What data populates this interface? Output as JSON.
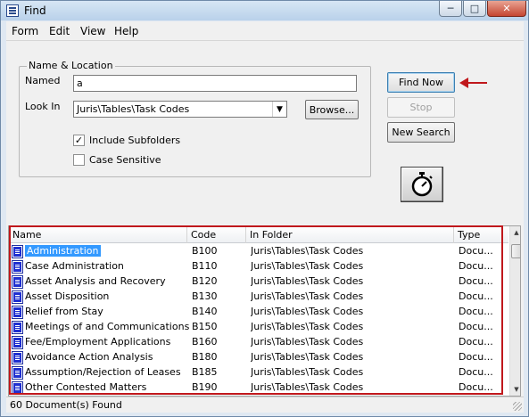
{
  "window": {
    "title": "Find"
  },
  "menu": [
    "Form",
    "Edit",
    "View",
    "Help"
  ],
  "name_location": {
    "legend": "Name & Location",
    "named_label": "Named",
    "named_value": "a",
    "lookin_label": "Look In",
    "lookin_value": "Juris\\Tables\\Task Codes",
    "browse_label": "Browse...",
    "include_subfolders_label": "Include Subfolders",
    "include_subfolders_checked": true,
    "case_sensitive_label": "Case Sensitive",
    "case_sensitive_checked": false
  },
  "buttons": {
    "find_now": "Find Now",
    "stop": "Stop",
    "new_search": "New Search"
  },
  "icons": {
    "stopwatch": "stopwatch-icon",
    "annotation_arrow": "red-arrow-icon",
    "annotation_color": "#c0181c"
  },
  "results": {
    "columns": [
      "Name",
      "Code",
      "In Folder",
      "Type"
    ],
    "rows": [
      {
        "name": "Administration",
        "code": "B100",
        "folder": "Juris\\Tables\\Task Codes",
        "type": "Docu..."
      },
      {
        "name": "Case Administration",
        "code": "B110",
        "folder": "Juris\\Tables\\Task Codes",
        "type": "Docu..."
      },
      {
        "name": "Asset Analysis and Recovery",
        "code": "B120",
        "folder": "Juris\\Tables\\Task Codes",
        "type": "Docu..."
      },
      {
        "name": "Asset Disposition",
        "code": "B130",
        "folder": "Juris\\Tables\\Task Codes",
        "type": "Docu..."
      },
      {
        "name": "Relief from Stay",
        "code": "B140",
        "folder": "Juris\\Tables\\Task Codes",
        "type": "Docu..."
      },
      {
        "name": "Meetings of and Communications",
        "code": "B150",
        "folder": "Juris\\Tables\\Task Codes",
        "type": "Docu..."
      },
      {
        "name": "Fee/Employment Applications",
        "code": "B160",
        "folder": "Juris\\Tables\\Task Codes",
        "type": "Docu..."
      },
      {
        "name": "Avoidance Action Analysis",
        "code": "B180",
        "folder": "Juris\\Tables\\Task Codes",
        "type": "Docu..."
      },
      {
        "name": "Assumption/Rejection of Leases",
        "code": "B185",
        "folder": "Juris\\Tables\\Task Codes",
        "type": "Docu..."
      },
      {
        "name": "Other Contested Matters",
        "code": "B190",
        "folder": "Juris\\Tables\\Task Codes",
        "type": "Docu..."
      }
    ],
    "selected_index": 0
  },
  "status": {
    "text": "60 Document(s) Found"
  }
}
